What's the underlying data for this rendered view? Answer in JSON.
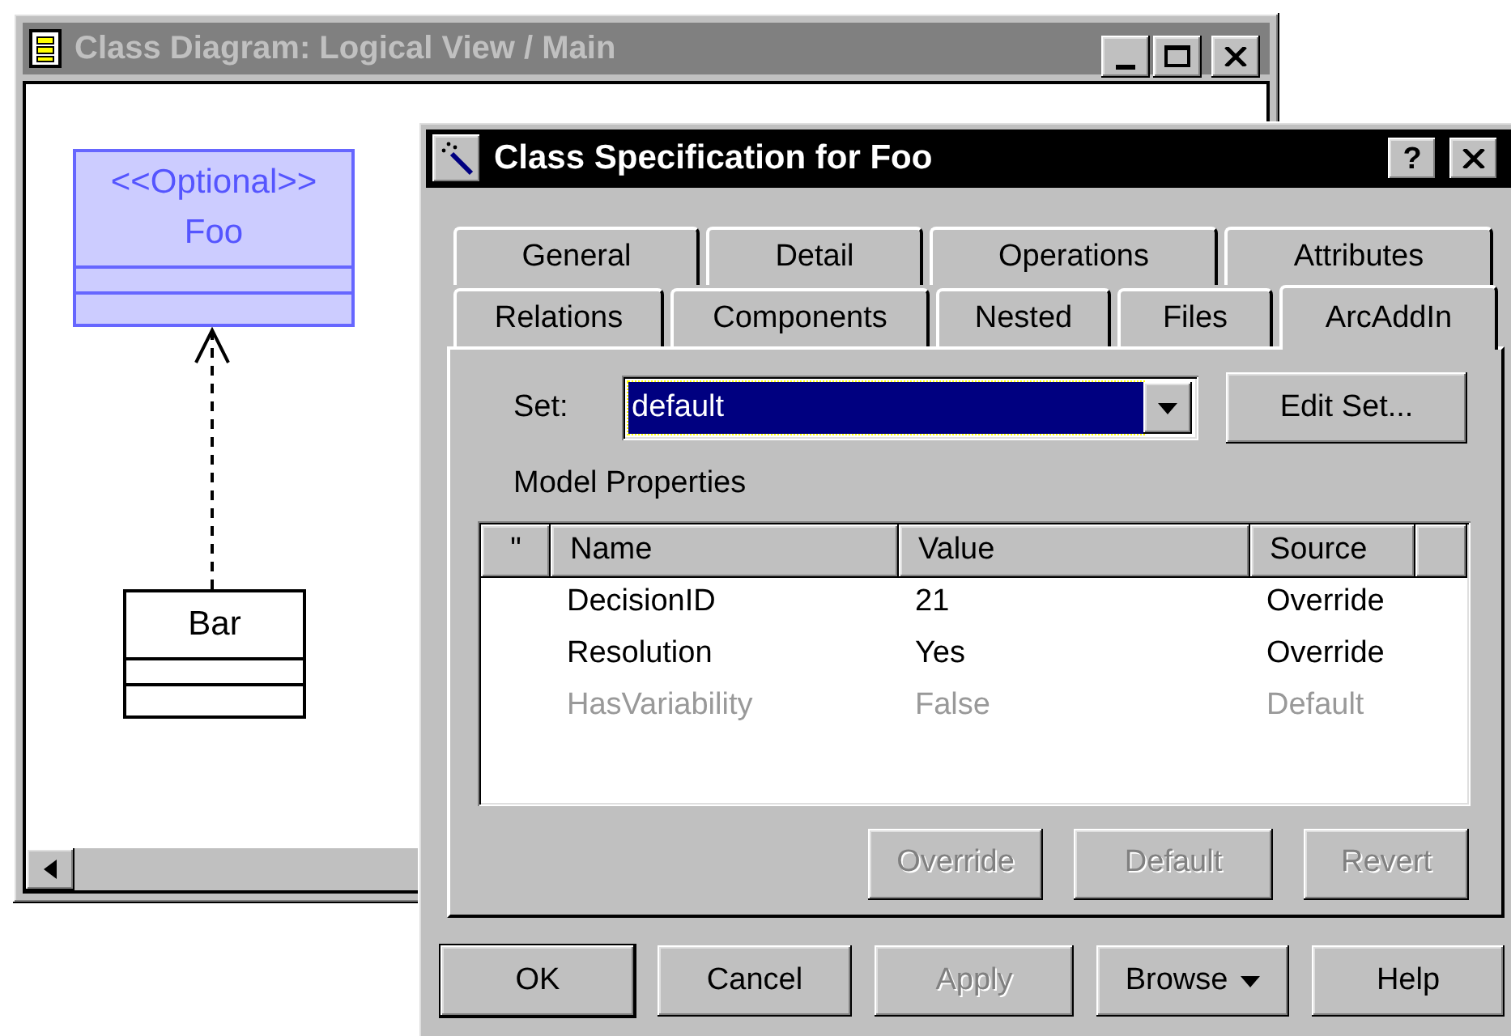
{
  "diagram_window": {
    "title": "Class Diagram: Logical View / Main",
    "active": false
  },
  "diagram": {
    "classes": [
      {
        "kind": "stereotyped",
        "stereotype": "<<Optional>>",
        "name": "Foo",
        "selected": true
      },
      {
        "kind": "plain",
        "name": "Bar",
        "selected": false
      }
    ]
  },
  "dialog": {
    "title": "Class Specification for Foo",
    "help_button": "?",
    "tab_rows": [
      [
        {
          "label": "General",
          "selected": false
        },
        {
          "label": "Detail",
          "selected": false
        },
        {
          "label": "Operations",
          "selected": false
        },
        {
          "label": "Attributes",
          "selected": false
        }
      ],
      [
        {
          "label": "Relations",
          "selected": false
        },
        {
          "label": "Components",
          "selected": false
        },
        {
          "label": "Nested",
          "selected": false
        },
        {
          "label": "Files",
          "selected": false
        },
        {
          "label": "ArcAddIn",
          "selected": true
        }
      ]
    ],
    "set": {
      "label": "Set:",
      "value": "default"
    },
    "edit_set_button": "Edit Set...",
    "model_properties_label": "Model Properties",
    "table": {
      "columns": [
        "\"",
        "Name",
        "Value",
        "Source"
      ],
      "rows": [
        {
          "name": "DecisionID",
          "value": "21",
          "source": "Override",
          "disabled": false
        },
        {
          "name": "Resolution",
          "value": "Yes",
          "source": "Override",
          "disabled": false
        },
        {
          "name": "HasVariability",
          "value": "False",
          "source": "Default",
          "disabled": true
        }
      ]
    },
    "action_buttons": [
      {
        "label": "Override",
        "disabled": true
      },
      {
        "label": "Default",
        "disabled": true
      },
      {
        "label": "Revert",
        "disabled": true
      }
    ],
    "footer_buttons": [
      {
        "label": "OK",
        "kind": "default",
        "disabled": false
      },
      {
        "label": "Cancel",
        "kind": "plain",
        "disabled": false
      },
      {
        "label": "Apply",
        "kind": "plain",
        "disabled": true
      },
      {
        "label": "Browse",
        "kind": "menu",
        "disabled": false
      },
      {
        "label": "Help",
        "kind": "plain",
        "disabled": false
      }
    ]
  }
}
